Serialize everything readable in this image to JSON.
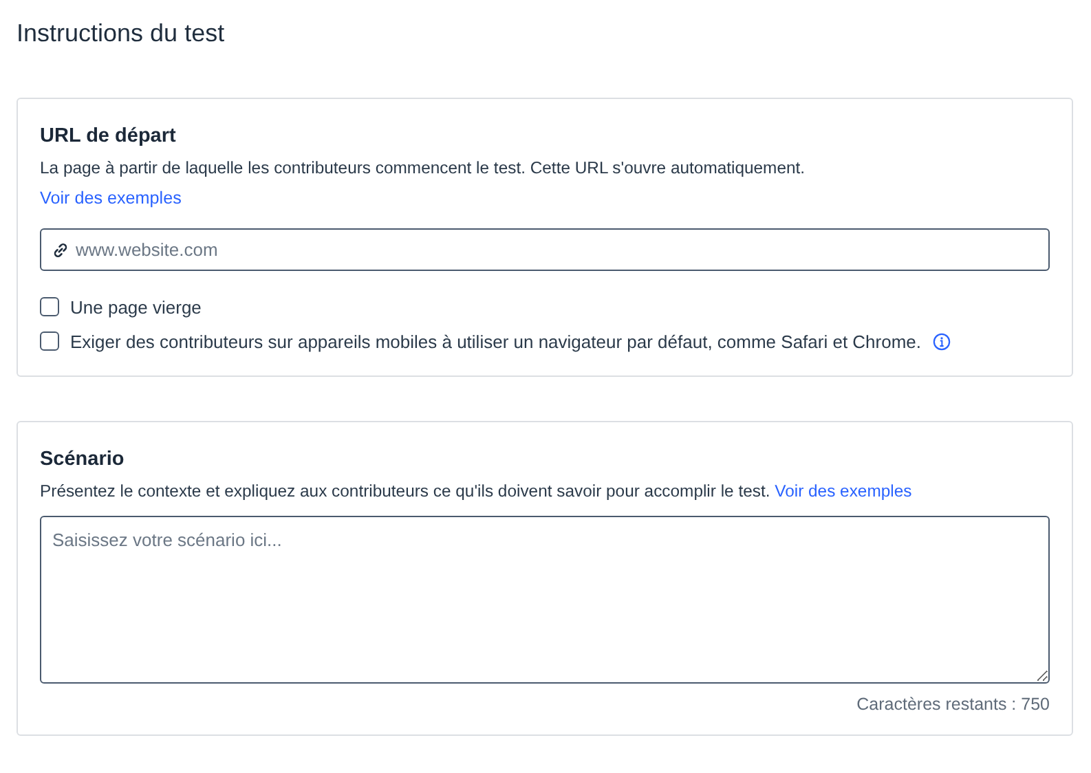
{
  "page_title": "Instructions du test",
  "start_url": {
    "heading": "URL de départ",
    "description": "La page à partir de laquelle les contributeurs commencent le test. Cette URL s'ouvre automatiquement.",
    "link": "Voir des exemples",
    "url_field": {
      "placeholder": "www.website.com"
    },
    "options": [
      {
        "label": "Une page vierge",
        "checked": false,
        "info": false
      },
      {
        "label": "Exiger des contributeurs sur appareils mobiles à utiliser un navigateur par défaut, comme Safari et Chrome.",
        "checked": false,
        "info": true
      }
    ]
  },
  "scenario": {
    "heading": "Scénario",
    "description": "Présentez le contexte et expliquez aux contributeurs ce qu'ils doivent savoir pour accomplir le test.",
    "link": "Voir des exemples",
    "text_field": {
      "placeholder": "Saisissez votre scénario ici..."
    },
    "counter": "Caractères restants : 750"
  }
}
